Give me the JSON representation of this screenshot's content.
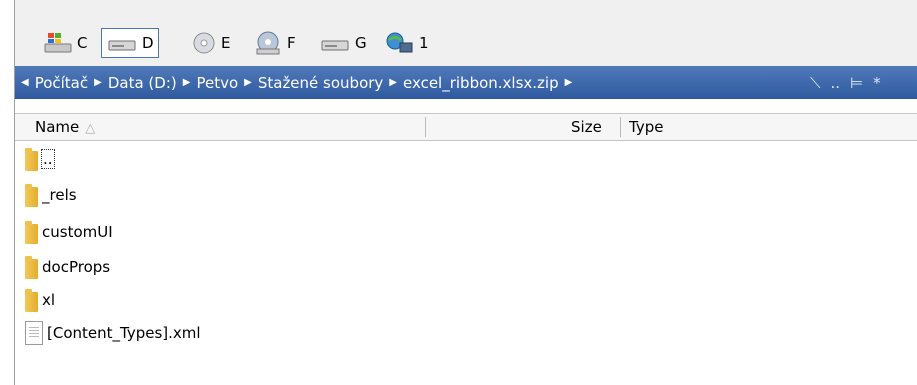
{
  "drives": [
    {
      "name": "drive-c",
      "label": "C",
      "icon": "windows-drive-icon"
    },
    {
      "name": "drive-d",
      "label": "D",
      "icon": "hard-drive-icon",
      "active": true
    },
    {
      "name": "drive-e",
      "label": "E",
      "icon": "optical-drive-icon"
    },
    {
      "name": "drive-f",
      "label": "F",
      "icon": "cd-drive-icon"
    },
    {
      "name": "drive-g",
      "label": "G",
      "icon": "hard-drive-icon"
    },
    {
      "name": "drive-1",
      "label": "1",
      "icon": "network-icon"
    }
  ],
  "path": {
    "segments": [
      "Počítač",
      "Data (D:)",
      "Petvo",
      "Stažené soubory",
      "excel_ribbon.xlsx.zip"
    ],
    "tools": [
      "⟍",
      "..",
      "⊨",
      "*"
    ]
  },
  "columns": {
    "name": "Name",
    "sort_indicator": "△",
    "size": "Size",
    "type": "Type"
  },
  "files": [
    {
      "name": "..",
      "kind": "folder"
    },
    {
      "name": "_rels",
      "kind": "folder"
    },
    {
      "name": "customUI",
      "kind": "folder"
    },
    {
      "name": "docProps",
      "kind": "folder"
    },
    {
      "name": "xl",
      "kind": "folder"
    },
    {
      "name": "[Content_Types].xml",
      "kind": "file"
    }
  ],
  "colors": {
    "pathbar": "#3d68ad",
    "background": "#ffffff",
    "folder": "#e9b53a"
  }
}
